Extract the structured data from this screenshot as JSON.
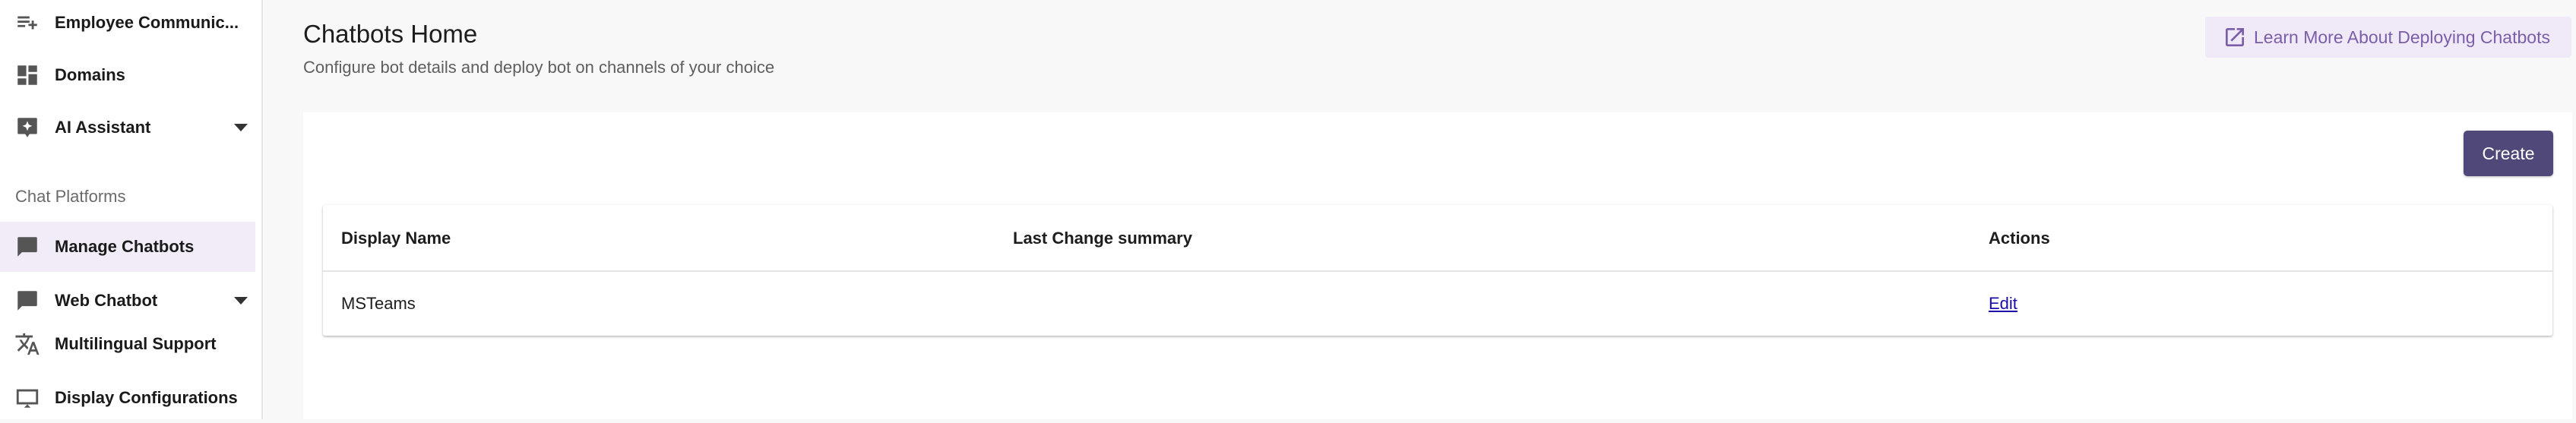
{
  "sidebar": {
    "items": [
      {
        "label": "Employee Communic...",
        "icon": "playlist-add-icon",
        "has_caret": false
      },
      {
        "label": "Domains",
        "icon": "dashboard-icon",
        "has_caret": false
      },
      {
        "label": "AI Assistant",
        "icon": "ai-sparkle-icon",
        "has_caret": true
      },
      {
        "label": "Manage Chatbots",
        "icon": "chat-bubble-icon",
        "has_caret": false,
        "active": true
      },
      {
        "label": "Web Chatbot",
        "icon": "chat-bubble-icon",
        "has_caret": true
      },
      {
        "label": "Multilingual Support",
        "icon": "translate-icon",
        "has_caret": false
      },
      {
        "label": "Display Configurations",
        "icon": "cast-display-icon",
        "has_caret": false
      }
    ],
    "section_label": "Chat Platforms"
  },
  "header": {
    "title": "Chatbots Home",
    "subtitle": "Configure bot details and deploy bot on channels of your choice",
    "learn_more_label": "Learn More About Deploying Chatbots"
  },
  "main": {
    "create_label": "Create",
    "table": {
      "columns": [
        "Display Name",
        "Last Change summary",
        "Actions"
      ],
      "rows": [
        {
          "display_name": "MSTeams",
          "last_change_summary": "",
          "action": "Edit"
        }
      ]
    }
  },
  "colors": {
    "accent": "#504878",
    "active_nav_bg": "#f1ecf8",
    "learn_more_bg": "#f0e9f8",
    "learn_more_text": "#7a5ea8",
    "link": "#1a0dab"
  }
}
